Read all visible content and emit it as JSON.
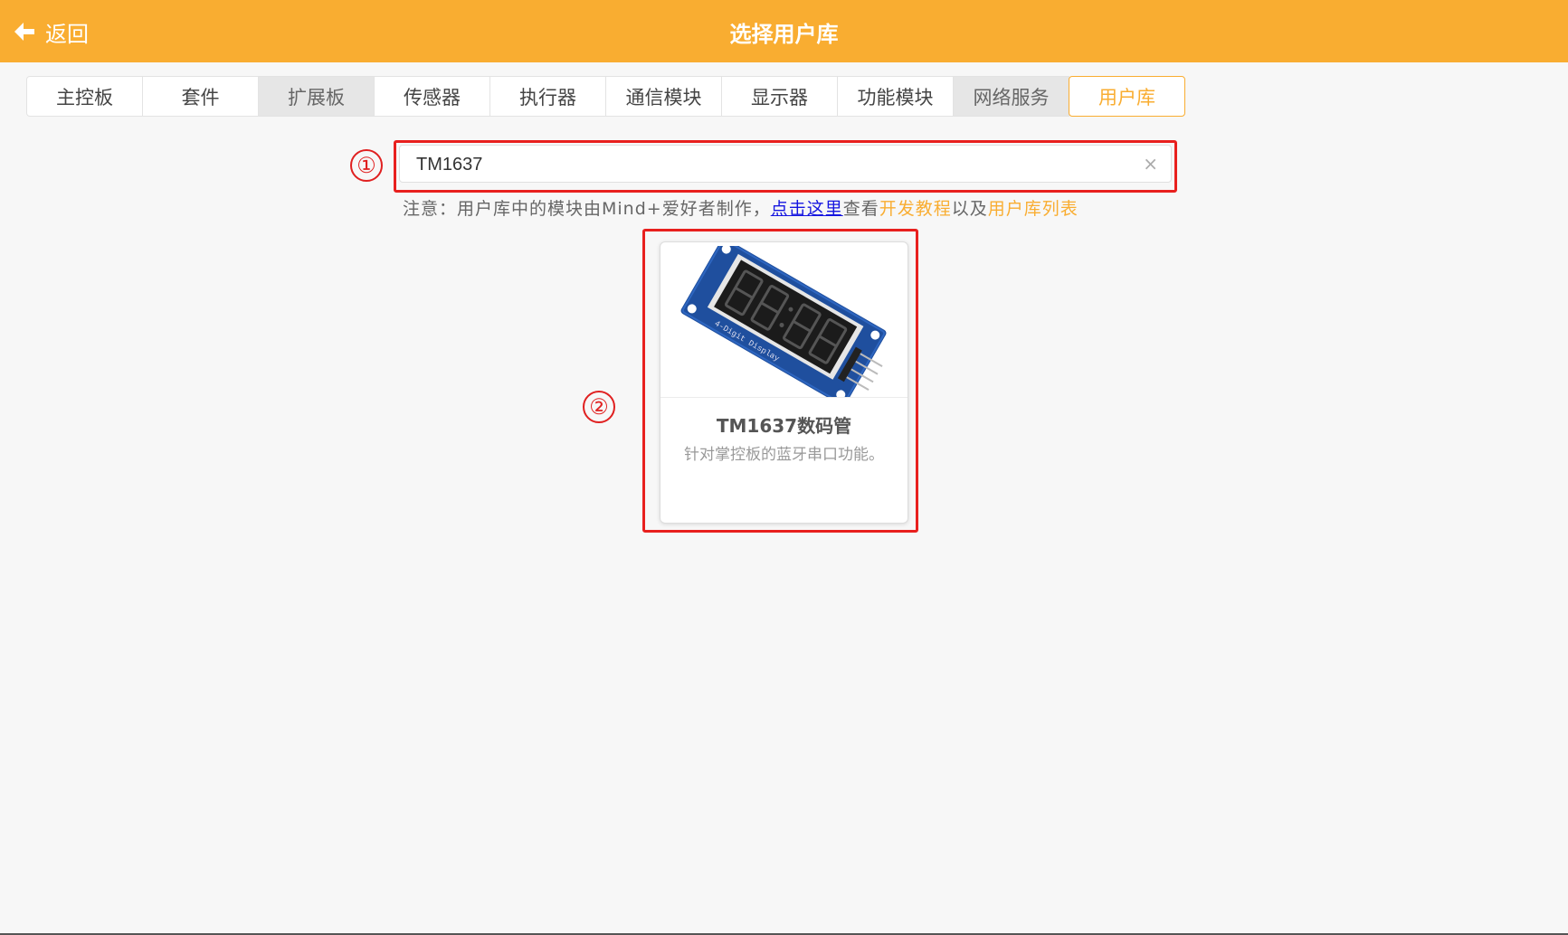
{
  "header": {
    "back_label": "返回",
    "title": "选择用户库",
    "accent_color": "#f9ad31"
  },
  "tabs": [
    {
      "label": "主控板",
      "state": "normal"
    },
    {
      "label": "套件",
      "state": "normal"
    },
    {
      "label": "扩展板",
      "state": "disabled"
    },
    {
      "label": "传感器",
      "state": "normal"
    },
    {
      "label": "执行器",
      "state": "normal"
    },
    {
      "label": "通信模块",
      "state": "normal"
    },
    {
      "label": "显示器",
      "state": "normal"
    },
    {
      "label": "功能模块",
      "state": "normal"
    },
    {
      "label": "网络服务",
      "state": "disabled"
    },
    {
      "label": "用户库",
      "state": "active"
    }
  ],
  "search": {
    "value": "TM1637",
    "clear_icon": "×"
  },
  "note": {
    "prefix": "注意：用户库中的模块由Mind+爱好者制作，",
    "link": "点击这里",
    "mid1": "查看",
    "tutorial": "开发教程",
    "mid2": "以及",
    "list": "用户库列表"
  },
  "annotations": {
    "marker1": "①",
    "marker2": "②",
    "highlight_color": "#e8201e"
  },
  "result_card": {
    "name": "TM1637数码管",
    "description": "针对掌控板的蓝牙串口功能。",
    "image_icon": "4-digit-display-module-image"
  }
}
